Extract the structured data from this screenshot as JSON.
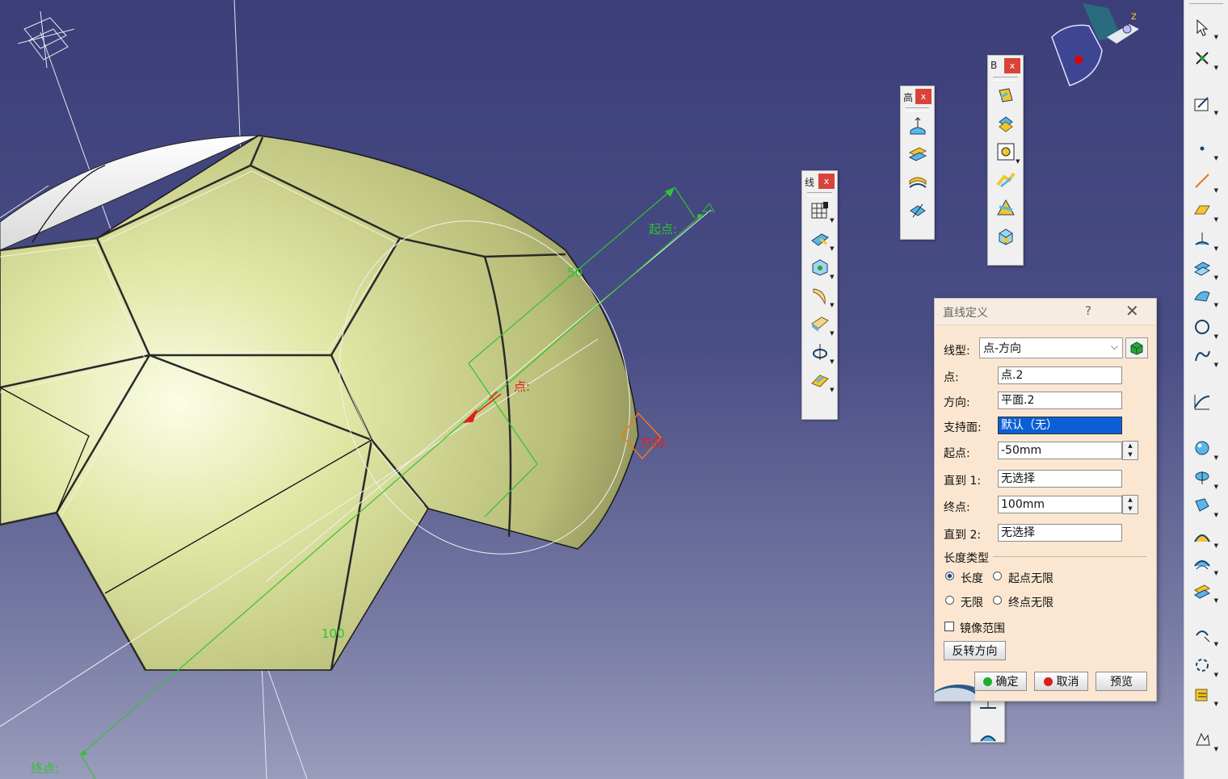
{
  "viewport": {
    "labels": {
      "start_point": "起点:",
      "end_point": "终点:",
      "point": "点:",
      "direction": "方向:",
      "dim_50": "50",
      "dim_100": "100"
    },
    "colors": {
      "background_top": "#3b3e78",
      "model_face": "#d8de9c",
      "construction_line": "#2fc42f",
      "point_marker": "#e02020",
      "direction_marker": "#f07a16"
    }
  },
  "compass": {
    "axis_label": "z"
  },
  "floating_toolbars": [
    {
      "title": "线",
      "close": "x",
      "buttons": [
        "grid-icon",
        "sweep-icon",
        "box-icon",
        "blend-icon",
        "fill-icon",
        "revolve-icon",
        "multi-section-icon"
      ]
    },
    {
      "title": "高",
      "close": "x",
      "buttons": [
        "extrude-surface-icon",
        "offset-icon",
        "variable-offset-icon",
        "rough-offset-icon"
      ]
    },
    {
      "title": "B",
      "close": "x",
      "buttons": [
        "join-icon",
        "healing-icon",
        "untrim-icon",
        "disassemble-icon",
        "split-icon",
        "trim-icon"
      ]
    }
  ],
  "dialog": {
    "title": "直线定义",
    "help": "?",
    "close": "✕",
    "line_type_label": "线型:",
    "line_type_value": "点-方向",
    "point_label": "点:",
    "point_value": "点.2",
    "direction_label": "方向:",
    "direction_value": "平面.2",
    "support_label": "支持面:",
    "support_value": "默认（无）",
    "start_label": "起点:",
    "start_value": "-50mm",
    "upto1_label": "直到 1:",
    "upto1_value": "无选择",
    "end_label": "终点:",
    "end_value": "100mm",
    "upto2_label": "直到 2:",
    "upto2_value": "无选择",
    "length_type_label": "长度类型",
    "radio_length": "长度",
    "radio_start_infinite": "起点无限",
    "radio_infinite": "无限",
    "radio_end_infinite": "终点无限",
    "selected_length_type": "长度",
    "mirror_label": "镜像范围",
    "mirror_checked": false,
    "reverse_button": "反转方向",
    "ok_button": "确定",
    "cancel_button": "取消",
    "preview_button": "预览"
  },
  "right_toolbar": {
    "buttons": [
      "select-arrow-icon",
      "snap-icon",
      "sketch-icon",
      "point-icon",
      "line-icon",
      "plane-icon",
      "extrude-icon",
      "offset-icon",
      "sweep-icon",
      "circle-icon",
      "spline-icon",
      "law-icon",
      "sphere-icon",
      "revolve-icon",
      "fill-icon",
      "blend-icon",
      "multi-section-icon",
      "join-icon",
      "symmetry-icon",
      "pattern-icon",
      "rep-icon",
      "knowledge-icon"
    ]
  }
}
